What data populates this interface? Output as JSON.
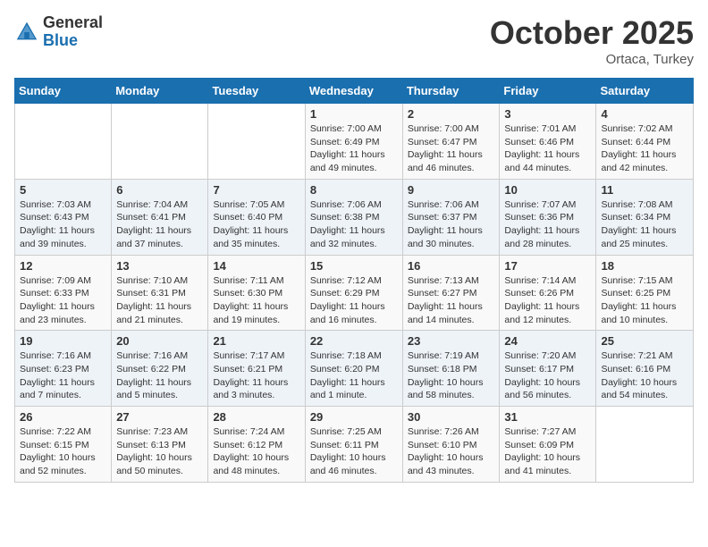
{
  "header": {
    "logo_general": "General",
    "logo_blue": "Blue",
    "month": "October 2025",
    "location": "Ortaca, Turkey"
  },
  "days_of_week": [
    "Sunday",
    "Monday",
    "Tuesday",
    "Wednesday",
    "Thursday",
    "Friday",
    "Saturday"
  ],
  "weeks": [
    [
      {
        "day": "",
        "info": ""
      },
      {
        "day": "",
        "info": ""
      },
      {
        "day": "",
        "info": ""
      },
      {
        "day": "1",
        "info": "Sunrise: 7:00 AM\nSunset: 6:49 PM\nDaylight: 11 hours\nand 49 minutes."
      },
      {
        "day": "2",
        "info": "Sunrise: 7:00 AM\nSunset: 6:47 PM\nDaylight: 11 hours\nand 46 minutes."
      },
      {
        "day": "3",
        "info": "Sunrise: 7:01 AM\nSunset: 6:46 PM\nDaylight: 11 hours\nand 44 minutes."
      },
      {
        "day": "4",
        "info": "Sunrise: 7:02 AM\nSunset: 6:44 PM\nDaylight: 11 hours\nand 42 minutes."
      }
    ],
    [
      {
        "day": "5",
        "info": "Sunrise: 7:03 AM\nSunset: 6:43 PM\nDaylight: 11 hours\nand 39 minutes."
      },
      {
        "day": "6",
        "info": "Sunrise: 7:04 AM\nSunset: 6:41 PM\nDaylight: 11 hours\nand 37 minutes."
      },
      {
        "day": "7",
        "info": "Sunrise: 7:05 AM\nSunset: 6:40 PM\nDaylight: 11 hours\nand 35 minutes."
      },
      {
        "day": "8",
        "info": "Sunrise: 7:06 AM\nSunset: 6:38 PM\nDaylight: 11 hours\nand 32 minutes."
      },
      {
        "day": "9",
        "info": "Sunrise: 7:06 AM\nSunset: 6:37 PM\nDaylight: 11 hours\nand 30 minutes."
      },
      {
        "day": "10",
        "info": "Sunrise: 7:07 AM\nSunset: 6:36 PM\nDaylight: 11 hours\nand 28 minutes."
      },
      {
        "day": "11",
        "info": "Sunrise: 7:08 AM\nSunset: 6:34 PM\nDaylight: 11 hours\nand 25 minutes."
      }
    ],
    [
      {
        "day": "12",
        "info": "Sunrise: 7:09 AM\nSunset: 6:33 PM\nDaylight: 11 hours\nand 23 minutes."
      },
      {
        "day": "13",
        "info": "Sunrise: 7:10 AM\nSunset: 6:31 PM\nDaylight: 11 hours\nand 21 minutes."
      },
      {
        "day": "14",
        "info": "Sunrise: 7:11 AM\nSunset: 6:30 PM\nDaylight: 11 hours\nand 19 minutes."
      },
      {
        "day": "15",
        "info": "Sunrise: 7:12 AM\nSunset: 6:29 PM\nDaylight: 11 hours\nand 16 minutes."
      },
      {
        "day": "16",
        "info": "Sunrise: 7:13 AM\nSunset: 6:27 PM\nDaylight: 11 hours\nand 14 minutes."
      },
      {
        "day": "17",
        "info": "Sunrise: 7:14 AM\nSunset: 6:26 PM\nDaylight: 11 hours\nand 12 minutes."
      },
      {
        "day": "18",
        "info": "Sunrise: 7:15 AM\nSunset: 6:25 PM\nDaylight: 11 hours\nand 10 minutes."
      }
    ],
    [
      {
        "day": "19",
        "info": "Sunrise: 7:16 AM\nSunset: 6:23 PM\nDaylight: 11 hours\nand 7 minutes."
      },
      {
        "day": "20",
        "info": "Sunrise: 7:16 AM\nSunset: 6:22 PM\nDaylight: 11 hours\nand 5 minutes."
      },
      {
        "day": "21",
        "info": "Sunrise: 7:17 AM\nSunset: 6:21 PM\nDaylight: 11 hours\nand 3 minutes."
      },
      {
        "day": "22",
        "info": "Sunrise: 7:18 AM\nSunset: 6:20 PM\nDaylight: 11 hours\nand 1 minute."
      },
      {
        "day": "23",
        "info": "Sunrise: 7:19 AM\nSunset: 6:18 PM\nDaylight: 10 hours\nand 58 minutes."
      },
      {
        "day": "24",
        "info": "Sunrise: 7:20 AM\nSunset: 6:17 PM\nDaylight: 10 hours\nand 56 minutes."
      },
      {
        "day": "25",
        "info": "Sunrise: 7:21 AM\nSunset: 6:16 PM\nDaylight: 10 hours\nand 54 minutes."
      }
    ],
    [
      {
        "day": "26",
        "info": "Sunrise: 7:22 AM\nSunset: 6:15 PM\nDaylight: 10 hours\nand 52 minutes."
      },
      {
        "day": "27",
        "info": "Sunrise: 7:23 AM\nSunset: 6:13 PM\nDaylight: 10 hours\nand 50 minutes."
      },
      {
        "day": "28",
        "info": "Sunrise: 7:24 AM\nSunset: 6:12 PM\nDaylight: 10 hours\nand 48 minutes."
      },
      {
        "day": "29",
        "info": "Sunrise: 7:25 AM\nSunset: 6:11 PM\nDaylight: 10 hours\nand 46 minutes."
      },
      {
        "day": "30",
        "info": "Sunrise: 7:26 AM\nSunset: 6:10 PM\nDaylight: 10 hours\nand 43 minutes."
      },
      {
        "day": "31",
        "info": "Sunrise: 7:27 AM\nSunset: 6:09 PM\nDaylight: 10 hours\nand 41 minutes."
      },
      {
        "day": "",
        "info": ""
      }
    ]
  ]
}
